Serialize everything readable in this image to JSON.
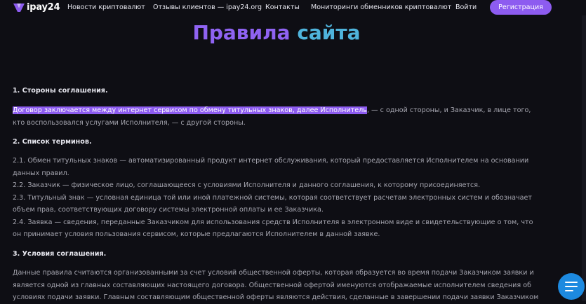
{
  "header": {
    "logo": "ipay24",
    "nav": [
      {
        "label": "Новости криптовалют"
      },
      {
        "label": "Отзывы клиентов — ipay24.org"
      },
      {
        "label": "Контакты"
      },
      {
        "label": "Мониторинги обменников криптовалют"
      },
      {
        "label": "Войти"
      }
    ],
    "register_label": "Регистрация"
  },
  "page": {
    "title_part1": "Правила",
    "title_part2": "сайта"
  },
  "sections": {
    "s1_heading": "1. Стороны соглашения.",
    "s1_highlight": "Договор заключается между интернет сервисом по обмену титульных знаков, далее Исполнитель",
    "s1_rest": ", — с одной стороны, и Заказчик, в лице того, кто воспользовался услугами Исполнителя, — с другой стороны.",
    "s2_heading": "2. Список терминов.",
    "s2_items": [
      "2.1. Обмен титульных знаков — автоматизированный продукт интернет обслуживания, который предоставляется Исполнителем на основании данных правил.",
      "2.2. Заказчик — физическое лицо, соглашающееся с условиями Исполнителя и данного соглашения, к которому присоединяется.",
      "2.3. Титульный знак — условная единица той или иной платежной системы, которая соответствует расчетам электронных систем и обозначает объем прав, соответствующих договору системы электронной оплаты и ее Заказчика.",
      "2.4. Заявка — сведения, переданные Заказчиком для использования средств Исполнителя в электронном виде и свидетельствующие о том, что он принимает условия пользования сервисом, которые предлагаются Исполнителем в данной заявке."
    ],
    "s3_heading": "3. Условия соглашения.",
    "s3_text": "Данные правила считаются организованными за счет условий общественной оферты, которая образуется во время подачи Заказчиком заявки и является одной из главных составляющих настоящего договора. Общественной офертой именуются отображаемые исполнителем сведения об условиях подачи заявки. Главным составляющим общественной оферты являются действия, сделанные в завершении подачи заявки Заказчиком"
  },
  "colors": {
    "background": "#0e0e14",
    "accent_purple": "#8d5cf0",
    "accent_blue": "#4fb4dc",
    "fab_blue": "#1d8ae0"
  },
  "icons": {
    "logo": "ipay24-logo-icon",
    "fab": "menu-lines-icon"
  }
}
